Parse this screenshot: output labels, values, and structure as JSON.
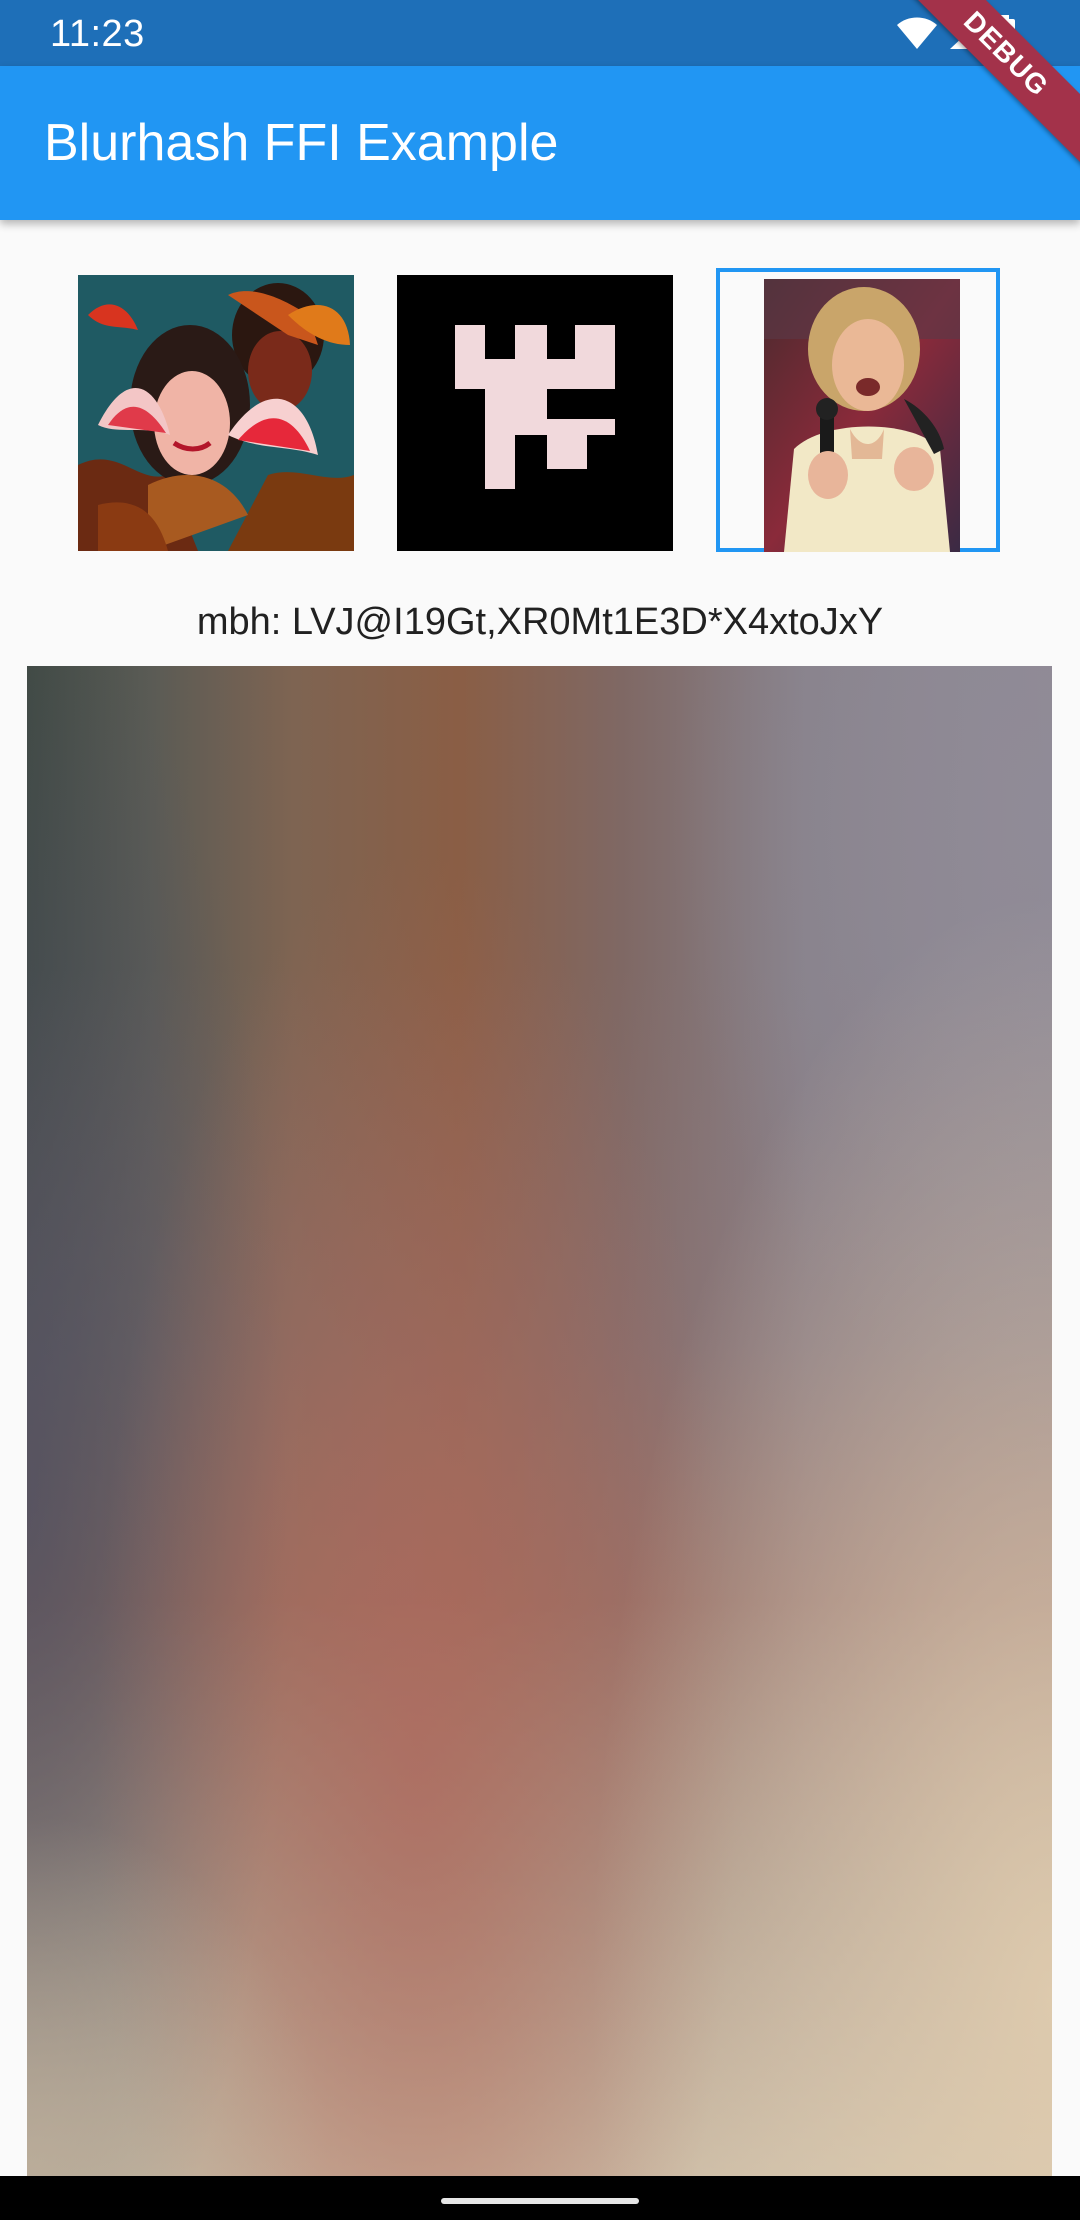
{
  "status_bar": {
    "time": "11:23",
    "icons": [
      "wifi-icon",
      "cellular-signal-icon",
      "battery-icon"
    ]
  },
  "app_bar": {
    "title": "Blurhash FFI Example",
    "color": "#2196f3"
  },
  "debug_banner": {
    "label": "DEBUG"
  },
  "thumbnails": {
    "selected_index": 2,
    "items": [
      {
        "image": "illustrated-portrait-thumbnail"
      },
      {
        "image": "pixel-pattern-thumbnail"
      },
      {
        "image": "photo-portrait-thumbnail"
      }
    ]
  },
  "hash_label": "mbh: LVJ@I19Gt,XR0Mt1E3D*X4xtoJxY",
  "colors": {
    "accent": "#2196f3",
    "status_bar": "#1e6fb8",
    "background": "#fafafa"
  }
}
